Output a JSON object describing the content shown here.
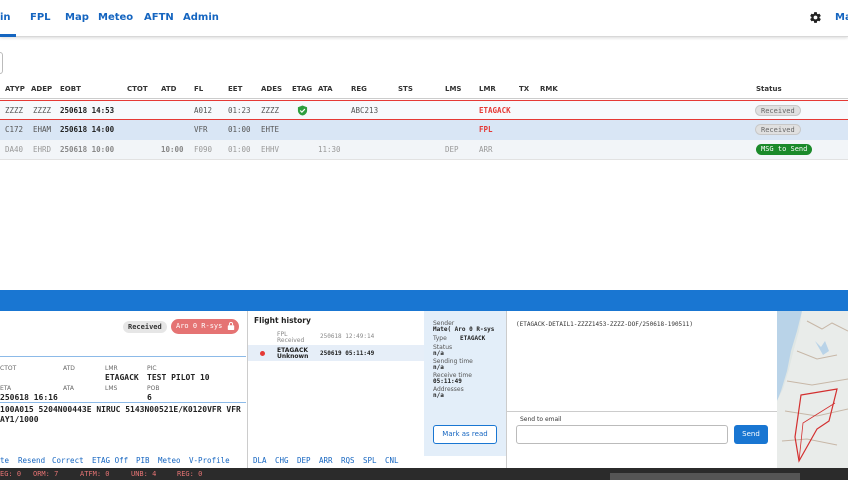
{
  "nav": {
    "tabs": [
      "in",
      "FPL",
      "Map",
      "Meteo",
      "AFTN",
      "Admin"
    ],
    "user": "Mat"
  },
  "table": {
    "headers": [
      "ATYP",
      "ADEP",
      "EOBT",
      "CTOT",
      "ATD",
      "FL",
      "EET",
      "ADES",
      "ETAG",
      "ATA",
      "REG",
      "STS",
      "LMS",
      "LMR",
      "TX",
      "RMK",
      "Status"
    ],
    "rows": [
      {
        "atyp": "ZZZZ",
        "adep": "ZZZZ",
        "eobt": "250618 14:53",
        "ctot": "",
        "atd": "",
        "fl": "A012",
        "eet": "01:23",
        "ades": "ZZZZ",
        "etag": "check",
        "ata": "",
        "reg": "ABC213",
        "sts": "",
        "lms": "",
        "lmr": "ETAGACK",
        "status": "Received"
      },
      {
        "atyp": "C172",
        "adep": "EHAM",
        "eobt": "250618 14:00",
        "ctot": "",
        "atd": "",
        "fl": "VFR",
        "eet": "01:00",
        "ades": "EHTE",
        "etag": "",
        "ata": "",
        "reg": "",
        "sts": "",
        "lms": "",
        "lmr": "FPL",
        "status": "Received"
      },
      {
        "atyp": "DA40",
        "adep": "EHRD",
        "eobt": "250618 10:00",
        "ctot": "",
        "atd": "10:00",
        "fl": "F090",
        "eet": "01:00",
        "ades": "EHHV",
        "etag": "",
        "ata": "11:30",
        "reg": "",
        "sts": "",
        "lms": "DEP",
        "lmr": "ARR",
        "status": "MSG to Send"
      }
    ]
  },
  "detail": {
    "status_received": "Received",
    "aro_label": "Aro 0 R-sys",
    "labels": {
      "ctot": "CTOT",
      "atd": "ATD",
      "lmr": "LMR",
      "pic": "PIC",
      "eta": "ETA",
      "ata": "ATA",
      "lms": "LMS",
      "pob": "POB"
    },
    "lmr": "ETAGACK",
    "pic": "TEST PILOT 10",
    "eta": "250618 16:16",
    "pob": "6",
    "route_line1": "100A015 5204N00443E NIRUC 5143N00521E/K0120VFR VFR",
    "route_line2": "AY1/1000",
    "actions": [
      "te",
      "Resend",
      "Correct",
      "ETAG Off",
      "PIB",
      "Meteo",
      "V-Profile"
    ]
  },
  "history": {
    "title": "Flight history",
    "items": [
      {
        "type": "FPL",
        "sub": "Received",
        "time": "250618 12:49:14"
      },
      {
        "type": "ETAGACK",
        "sub": "Unknown",
        "time": "250619 05:11:49"
      }
    ],
    "actions": [
      "DLA",
      "CHG",
      "DEP",
      "ARR",
      "RQS",
      "SPL",
      "CNL"
    ]
  },
  "message": {
    "sender_label": "Sender",
    "sender": "Mate( Aro 0 R-sys",
    "type_label": "Type",
    "type": "ETAGACK",
    "status_label": "Status",
    "status": "n/a",
    "sending_label": "Sending time",
    "sending": "n/a",
    "receive_label": "Receive time",
    "receive": "05:11:49",
    "addresses_label": "Addresses",
    "addresses": "n/a",
    "mark_read": "Mark as read",
    "content": "(ETAGACK-DETAIL1-ZZZZ1453-ZZZZ-DOF/250618-190511)",
    "email_label": "Send to email",
    "send": "Send"
  },
  "statusbar": [
    "EG: 0",
    "ORM: 7",
    "ATFM: 0",
    "UNB: 4",
    "REG: 0"
  ],
  "colors": {
    "primary": "#1976d2",
    "alert": "#e53935",
    "ok": "#1b8a2a"
  }
}
